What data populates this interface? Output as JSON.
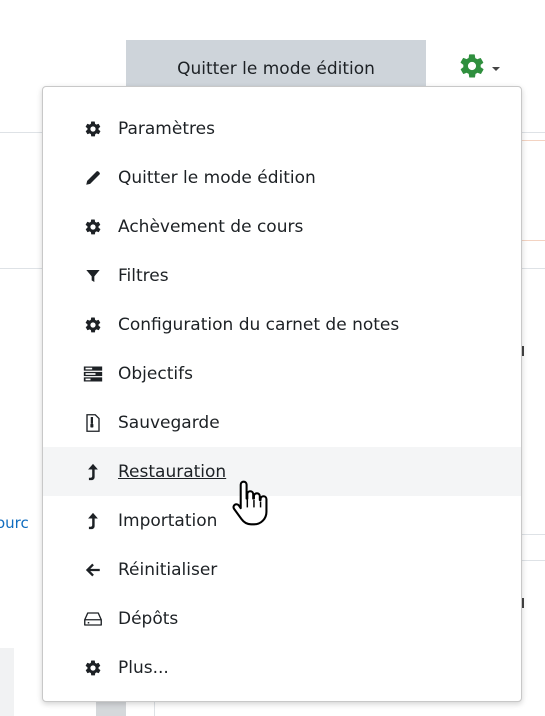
{
  "toolbar": {
    "edit_mode_label": "Quitter le mode édition",
    "settings_toggle_icon": "gear-icon",
    "accent_color": "#2f8f3e"
  },
  "background": {
    "partial_link_text": "ourc"
  },
  "menu": {
    "items": [
      {
        "icon": "gear-icon",
        "label": "Paramètres"
      },
      {
        "icon": "pencil-icon",
        "label": "Quitter le mode édition"
      },
      {
        "icon": "gear-icon",
        "label": "Achèvement de cours"
      },
      {
        "icon": "filter-icon",
        "label": "Filtres"
      },
      {
        "icon": "gear-icon",
        "label": "Configuration du carnet de notes"
      },
      {
        "icon": "outcomes-icon",
        "label": "Objectifs"
      },
      {
        "icon": "backup-file-icon",
        "label": "Sauvegarde"
      },
      {
        "icon": "upload-arrow-icon",
        "label": "Restauration"
      },
      {
        "icon": "upload-arrow-icon",
        "label": "Importation"
      },
      {
        "icon": "arrow-left-icon",
        "label": "Réinitialiser"
      },
      {
        "icon": "inbox-icon",
        "label": "Dépôts"
      },
      {
        "icon": "gear-icon",
        "label": "Plus..."
      }
    ],
    "hovered_label": "Restauration"
  }
}
